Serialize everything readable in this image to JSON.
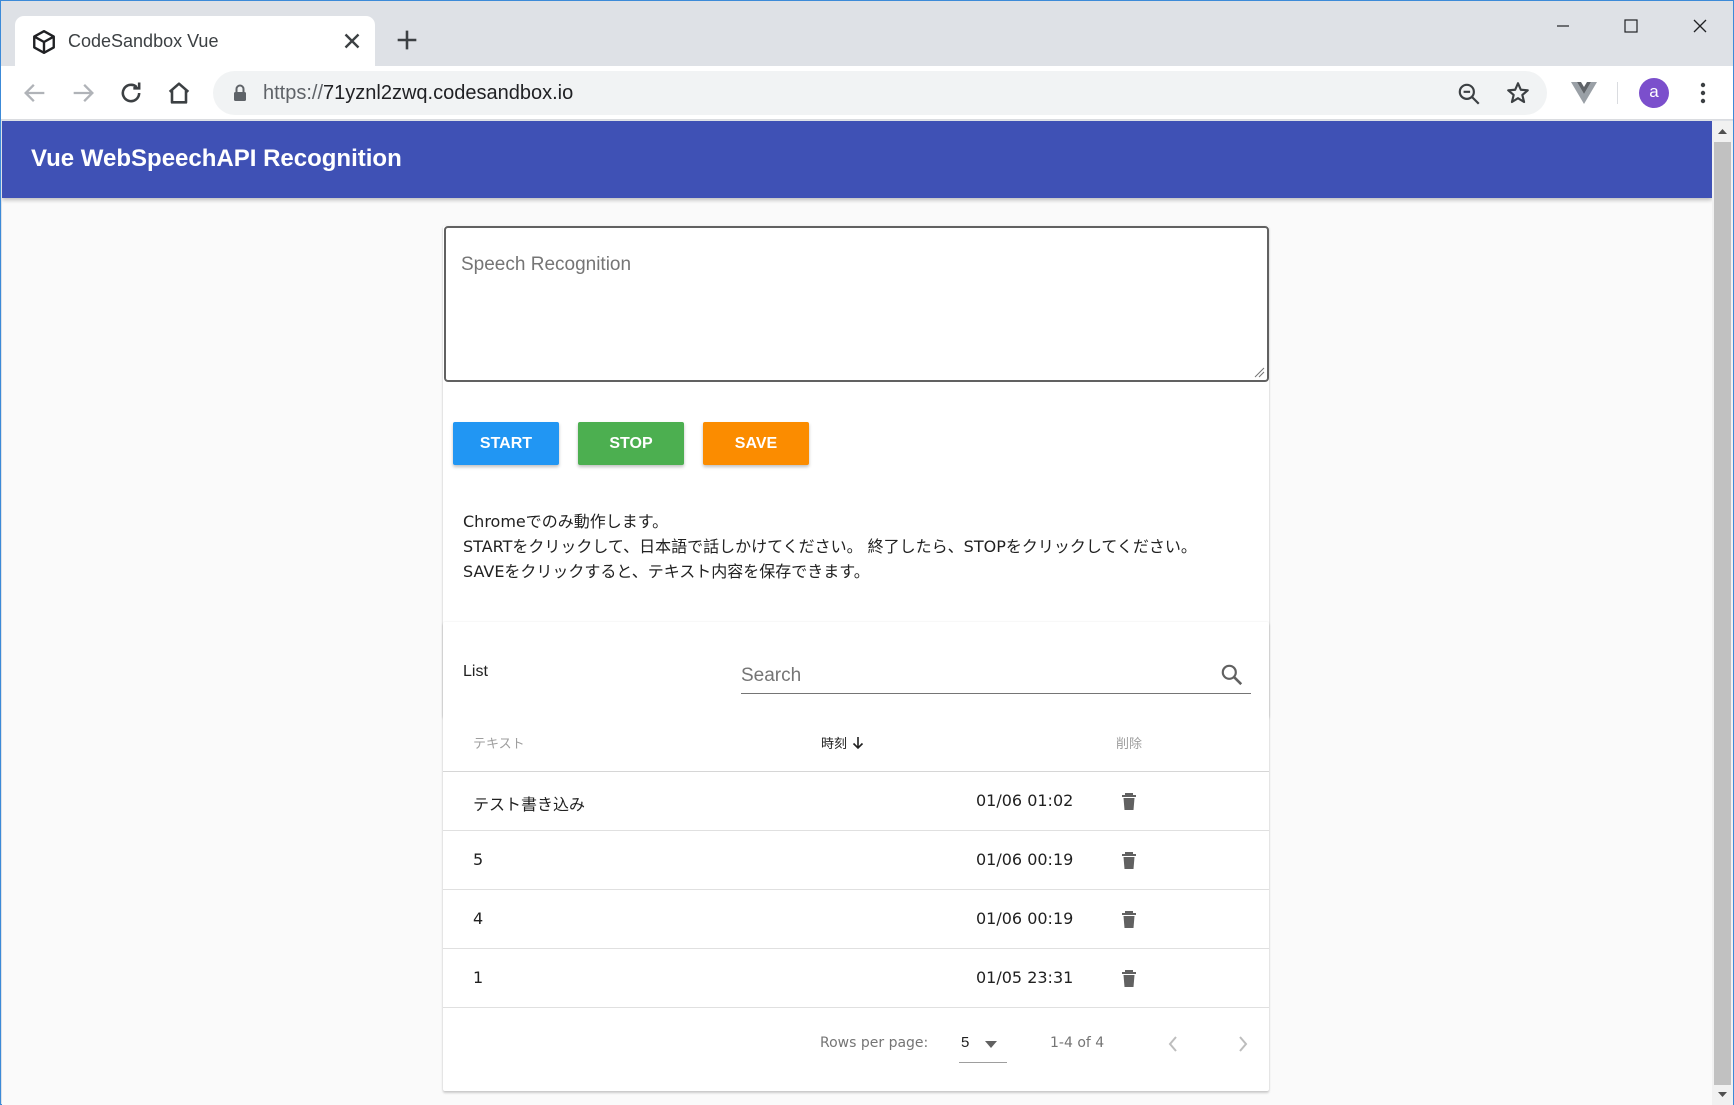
{
  "browser": {
    "tab_title": "CodeSandbox Vue",
    "url_scheme": "https://",
    "url_host": "71yznl2zwq.codesandbox.io",
    "avatar_letter": "a",
    "icons": [
      "codesandbox-favicon-icon",
      "close-icon",
      "plus-icon",
      "minimize-icon",
      "maximize-icon",
      "window-close-icon",
      "back-arrow-icon",
      "forward-arrow-icon",
      "reload-icon",
      "home-icon",
      "lock-icon",
      "zoom-out-icon",
      "star-icon",
      "vue-devtools-icon",
      "kebab-menu-icon"
    ]
  },
  "app": {
    "title": "Vue WebSpeechAPI Recognition",
    "accent_color": "#3f51b5"
  },
  "recognition": {
    "textarea_placeholder": "Speech Recognition",
    "start_label": "START",
    "stop_label": "STOP",
    "save_label": "SAVE",
    "start_color": "#2196f3",
    "stop_color": "#4caf50",
    "save_color": "#fb8c00",
    "help_lines": [
      "Chromeでのみ動作します。",
      "STARTをクリックして、日本語で話しかけてください。 終了したら、STOPをクリックしてください。",
      "SAVEをクリックすると、テキスト内容を保存できます。"
    ]
  },
  "list": {
    "title": "List",
    "search_label": "Search",
    "columns": {
      "text": "テキスト",
      "time": "時刻",
      "delete": "削除"
    },
    "rows": [
      {
        "text": "テスト書き込み",
        "time": "01/06 01:02"
      },
      {
        "text": "5",
        "time": "01/06 00:19"
      },
      {
        "text": "4",
        "time": "01/06 00:19"
      },
      {
        "text": "1",
        "time": "01/05 23:31"
      }
    ],
    "footer": {
      "rows_per_page_label": "Rows per page:",
      "rows_per_page_value": "5",
      "range_text": "1-4 of 4"
    }
  }
}
